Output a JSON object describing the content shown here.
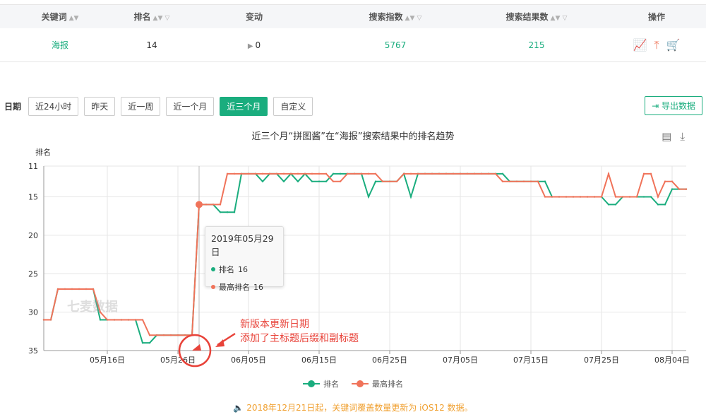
{
  "table": {
    "headers": [
      "关键词",
      "排名",
      "变动",
      "搜索指数",
      "搜索结果数",
      "操作"
    ],
    "row": {
      "keyword": "海报",
      "rank": "14",
      "change": "0",
      "search_index": "5767",
      "result_count": "215"
    }
  },
  "filters": {
    "label": "日期",
    "options": [
      "近24小时",
      "昨天",
      "近一周",
      "近一个月",
      "近三个月",
      "自定义"
    ],
    "active": "近三个月",
    "export_label": "导出数据"
  },
  "notice": "2018年12月21日起，关键词覆盖数量更新为 iOS12 数据。",
  "annotation": {
    "line1": "新版本更新日期",
    "line2": "添加了主标题后缀和副标题"
  },
  "watermark": "七麦数据",
  "tooltip": {
    "date": "2019年05月29日",
    "rows": [
      {
        "label": "排名",
        "value": "16",
        "color": "#1aad7e"
      },
      {
        "label": "最高排名",
        "value": "16",
        "color": "#f0735a"
      }
    ]
  },
  "chart_data": {
    "type": "line",
    "title": "近三个月“拼图酱”在“海报”搜索结果中的排名趋势",
    "ylabel": "排名",
    "y_inverted": true,
    "ylim": [
      11,
      35
    ],
    "yticks": [
      11,
      15,
      20,
      25,
      30,
      35
    ],
    "x_range": [
      "2019-05-07",
      "2019-08-06"
    ],
    "xticks": [
      "05月16日",
      "05月26日",
      "06月05日",
      "06月15日",
      "06月25日",
      "07月05日",
      "07月15日",
      "07月25日",
      "08月04日"
    ],
    "series": [
      {
        "name": "排名",
        "color": "#1aad7e",
        "values": [
          31,
          31,
          27,
          27,
          27,
          27,
          27,
          27,
          31,
          31,
          31,
          31,
          31,
          31,
          34,
          34,
          33,
          33,
          33,
          33,
          33,
          33,
          16,
          16,
          16,
          17,
          17,
          17,
          12,
          12,
          12,
          13,
          12,
          12,
          13,
          12,
          13,
          12,
          13,
          13,
          13,
          12,
          12,
          12,
          12,
          12,
          15,
          13,
          13,
          13,
          13,
          12,
          15,
          12,
          12,
          12,
          12,
          12,
          12,
          12,
          12,
          12,
          12,
          12,
          12,
          12,
          13,
          13,
          13,
          13,
          13,
          13,
          15,
          15,
          15,
          15,
          15,
          15,
          15,
          15,
          16,
          16,
          15,
          15,
          15,
          15,
          15,
          16,
          16,
          14,
          14,
          14
        ]
      },
      {
        "name": "最高排名",
        "color": "#f0735a",
        "values": [
          31,
          31,
          27,
          27,
          27,
          27,
          27,
          27,
          30,
          31,
          31,
          31,
          31,
          31,
          31,
          33,
          33,
          33,
          33,
          33,
          33,
          33,
          16,
          16,
          16,
          16,
          12,
          12,
          12,
          12,
          12,
          12,
          12,
          12,
          12,
          12,
          12,
          12,
          12,
          12,
          12,
          13,
          13,
          12,
          12,
          12,
          12,
          12,
          13,
          13,
          13,
          12,
          12,
          12,
          12,
          12,
          12,
          12,
          12,
          12,
          12,
          12,
          12,
          12,
          12,
          13,
          13,
          13,
          13,
          13,
          13,
          15,
          15,
          15,
          15,
          15,
          15,
          15,
          15,
          15,
          12,
          15,
          15,
          15,
          15,
          12,
          12,
          15,
          13,
          13,
          14,
          14
        ]
      }
    ]
  }
}
